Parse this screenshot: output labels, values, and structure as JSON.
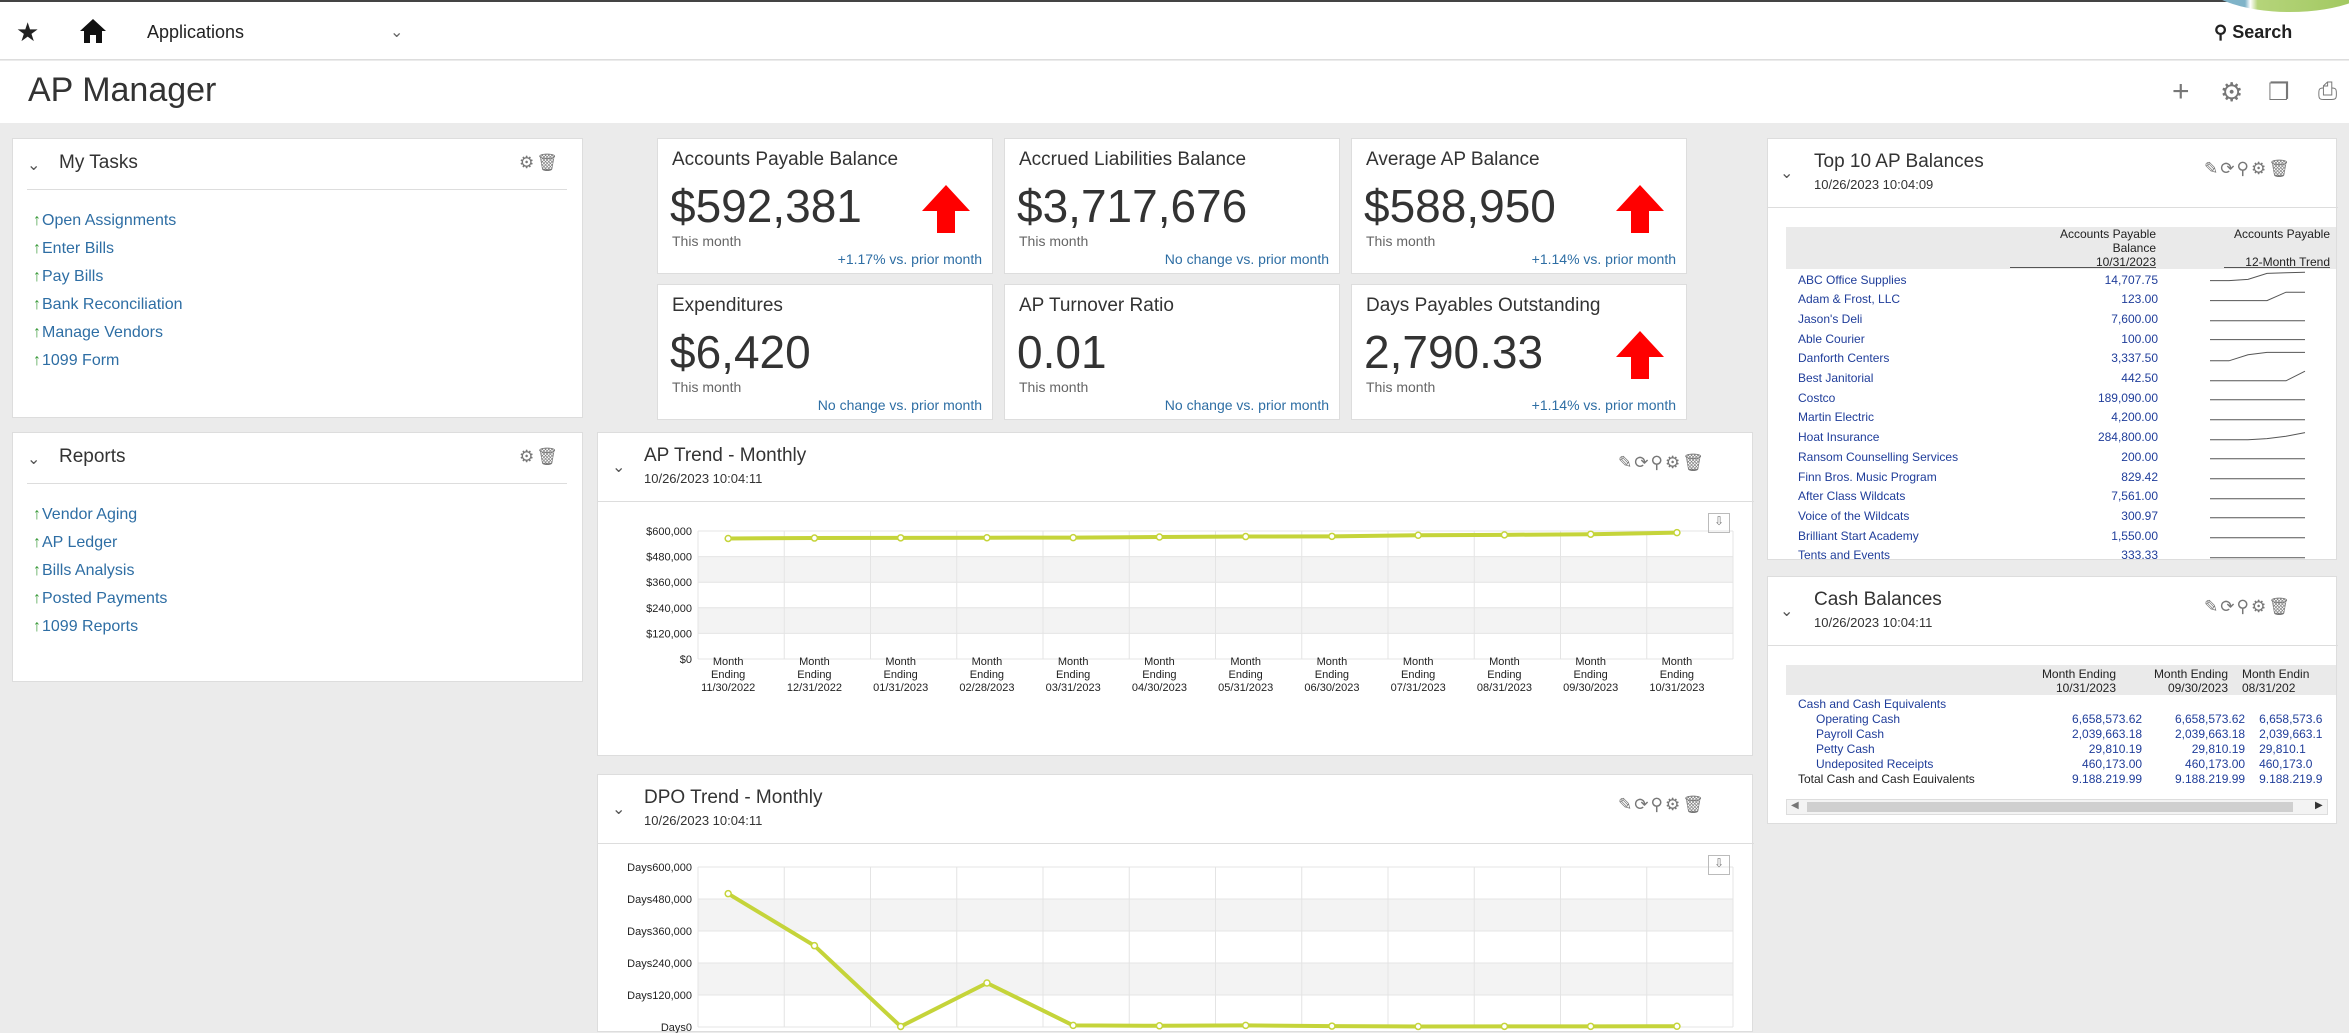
{
  "nav": {
    "apps_label": "Applications",
    "search_label": "Search"
  },
  "page": {
    "title": "AP Manager"
  },
  "my_tasks": {
    "title": "My Tasks",
    "items": [
      "Open Assignments",
      "Enter Bills",
      "Pay Bills",
      "Bank Reconciliation",
      "Manage Vendors",
      "1099 Form"
    ]
  },
  "reports": {
    "title": "Reports",
    "items": [
      "Vendor Aging",
      "AP Ledger",
      "Bills Analysis",
      "Posted Payments",
      "1099 Reports"
    ]
  },
  "kpis": [
    {
      "title": "Accounts Payable Balance",
      "value": "$592,381",
      "period": "This month",
      "change": "+1.17% vs. prior month",
      "arrow": true
    },
    {
      "title": "Accrued Liabilities Balance",
      "value": "$3,717,676",
      "period": "This month",
      "change": "No change vs. prior month",
      "arrow": false
    },
    {
      "title": "Average AP Balance",
      "value": "$588,950",
      "period": "This month",
      "change": "+1.14% vs. prior month",
      "arrow": true
    },
    {
      "title": "Expenditures",
      "value": "$6,420",
      "period": "This month",
      "change": "No change vs. prior month",
      "arrow": false
    },
    {
      "title": "AP Turnover Ratio",
      "value": "0.01",
      "period": "This month",
      "change": "No change vs. prior month",
      "arrow": false
    },
    {
      "title": "Days Payables Outstanding",
      "value": "2,790.33",
      "period": "This month",
      "change": "+1.14% vs. prior month",
      "arrow": true
    }
  ],
  "ap_trend": {
    "title": "AP Trend - Monthly",
    "timestamp": "10/26/2023 10:04:11",
    "chart_data": {
      "type": "line",
      "categories": [
        "11/30/2022",
        "12/31/2022",
        "01/31/2023",
        "02/28/2023",
        "03/31/2023",
        "04/30/2023",
        "05/31/2023",
        "06/30/2023",
        "07/31/2023",
        "08/31/2023",
        "09/30/2023",
        "10/31/2023"
      ],
      "category_prefix": [
        "Month",
        "Ending"
      ],
      "values": [
        565000,
        567000,
        568000,
        568500,
        569000,
        572000,
        574000,
        575000,
        580000,
        582000,
        585000,
        592381
      ],
      "yticks": [
        "$600,000",
        "$480,000",
        "$360,000",
        "$240,000",
        "$120,000",
        "$0"
      ],
      "ylim": [
        0,
        600000
      ],
      "color": "#c5d43a"
    }
  },
  "dpo_trend": {
    "title": "DPO Trend - Monthly",
    "timestamp": "10/26/2023 10:04:11",
    "chart_data": {
      "type": "line",
      "values": [
        500000,
        305000,
        2000,
        165000,
        6000,
        4500,
        6000,
        3500,
        2000,
        2500,
        2500,
        2790
      ],
      "yticks": [
        "Days600,000",
        "Days480,000",
        "Days360,000",
        "Days240,000",
        "Days120,000",
        "Days0"
      ],
      "ylim": [
        0,
        600000
      ],
      "color": "#c5d43a"
    }
  },
  "top10": {
    "title": "Top 10 AP Balances",
    "timestamp": "10/26/2023 10:04:09",
    "col1_header": [
      "Accounts Payable",
      "Balance",
      "10/31/2023"
    ],
    "col2_header": [
      "Accounts Payable",
      "",
      "12-Month Trend"
    ],
    "rows": [
      {
        "name": "ABC Office Supplies",
        "value": "14,707.75"
      },
      {
        "name": "Adam & Frost, LLC",
        "value": "123.00"
      },
      {
        "name": "Jason's Deli",
        "value": "7,600.00"
      },
      {
        "name": "Able Courier",
        "value": "100.00"
      },
      {
        "name": "Danforth Centers",
        "value": "3,337.50"
      },
      {
        "name": "Best Janitorial",
        "value": "442.50"
      },
      {
        "name": "Costco",
        "value": "189,090.00"
      },
      {
        "name": "Martin Electric",
        "value": "4,200.00"
      },
      {
        "name": "Hoat Insurance",
        "value": "284,800.00"
      },
      {
        "name": "Ransom Counselling Services",
        "value": "200.00"
      },
      {
        "name": "Finn Bros. Music Program",
        "value": "829.42"
      },
      {
        "name": "After Class Wildcats",
        "value": "7,561.00"
      },
      {
        "name": "Voice of the Wildcats",
        "value": "300.97"
      },
      {
        "name": "Brilliant Start Academy",
        "value": "1,550.00"
      },
      {
        "name": "Tents and Events",
        "value": "333.33"
      }
    ]
  },
  "cash": {
    "title": "Cash Balances",
    "timestamp": "10/26/2023 10:04:11",
    "headers": [
      [
        "Month Ending",
        "10/31/2023"
      ],
      [
        "Month Ending",
        "09/30/2023"
      ],
      [
        "Month Endin",
        "08/31/202"
      ]
    ],
    "rows": [
      {
        "label": "Cash and Cash Equivalents",
        "indent": false,
        "values": [
          "",
          "",
          ""
        ]
      },
      {
        "label": "Operating Cash",
        "indent": true,
        "values": [
          "6,658,573.62",
          "6,658,573.62",
          "6,658,573.6"
        ]
      },
      {
        "label": "Payroll Cash",
        "indent": true,
        "values": [
          "2,039,663.18",
          "2,039,663.18",
          "2,039,663.1"
        ]
      },
      {
        "label": "Petty Cash",
        "indent": true,
        "values": [
          "29,810.19",
          "29,810.19",
          "29,810.1"
        ]
      },
      {
        "label": "Undeposited Receipts",
        "indent": true,
        "values": [
          "460,173.00",
          "460,173.00",
          "460,173.0"
        ]
      },
      {
        "label": "Total Cash and Cash Equivalents",
        "indent": false,
        "values": [
          "9,188,219.99",
          "9,188,219.99",
          "9,188,219.9"
        ]
      }
    ]
  }
}
